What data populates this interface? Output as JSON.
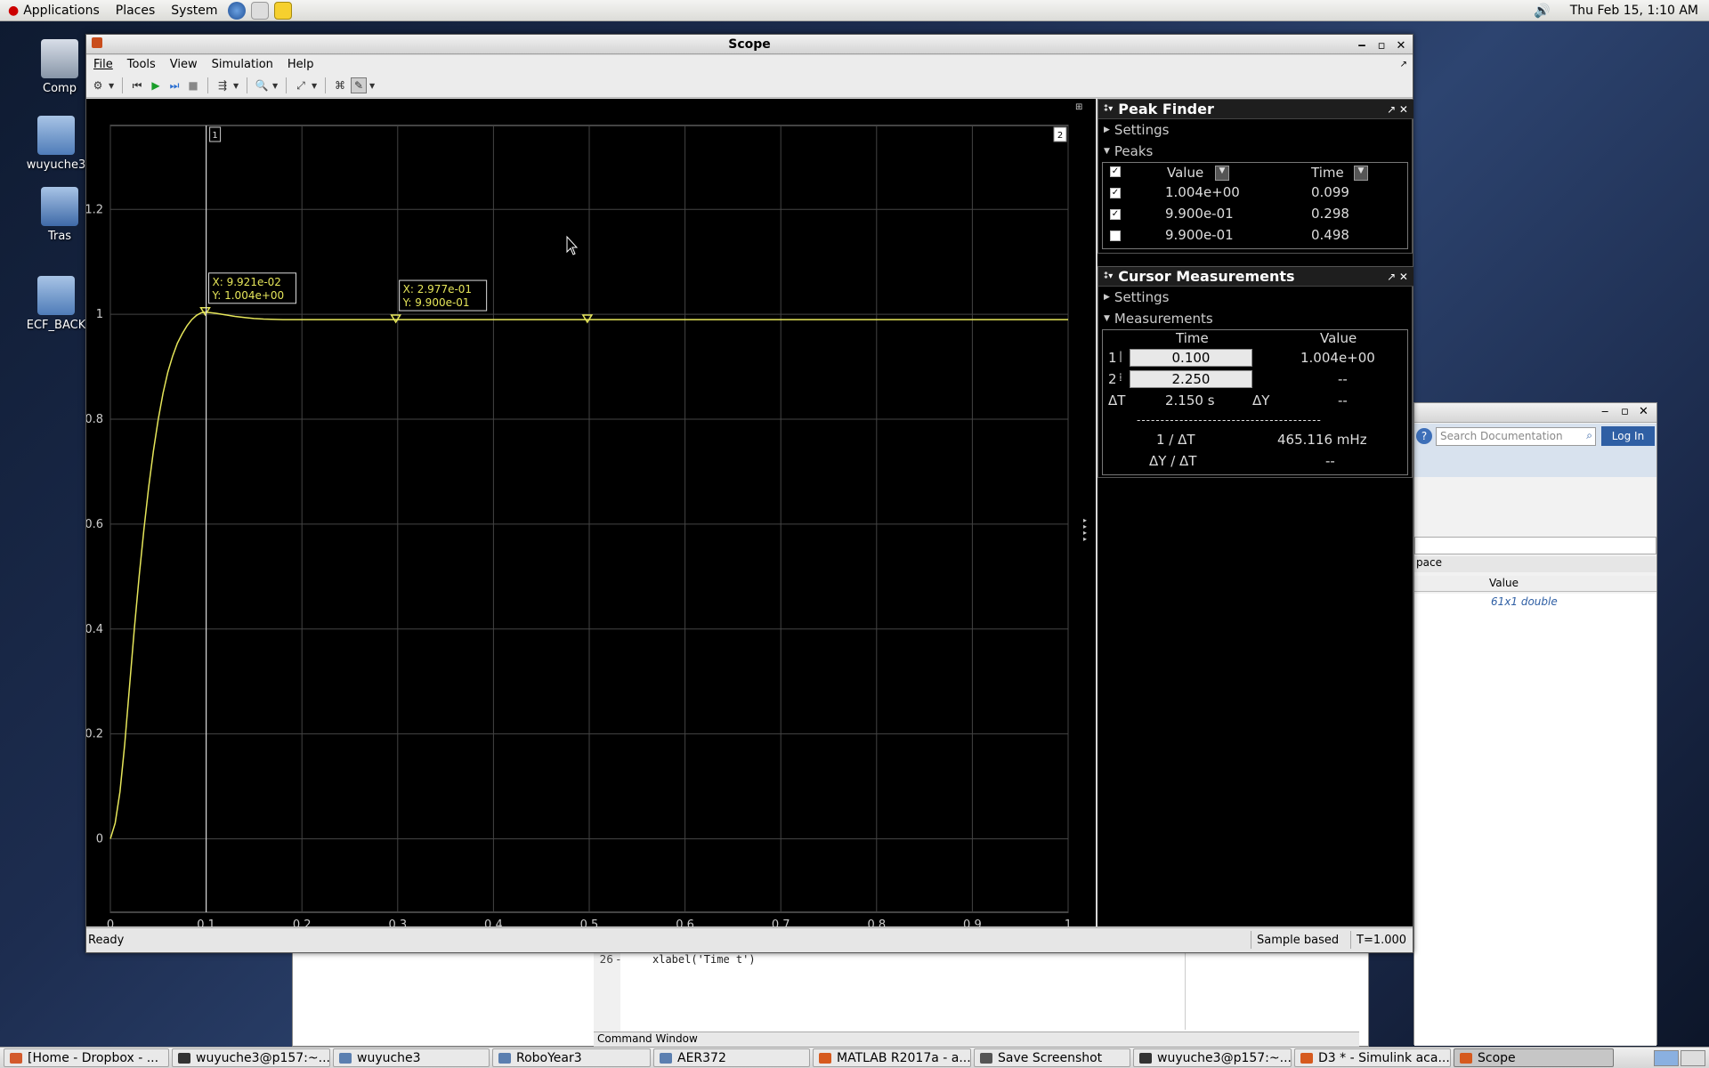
{
  "top_panel": {
    "applications": "Applications",
    "places": "Places",
    "system": "System",
    "clock": "Thu Feb 15,  1:10 AM"
  },
  "desktop_icons": [
    {
      "label": "Comp"
    },
    {
      "label": "wuyuche3"
    },
    {
      "label": "Tras"
    },
    {
      "label": "ECF_BACK"
    }
  ],
  "matlab_window": {
    "search_placeholder": "Search Documentation",
    "login": "Log In",
    "workspace_partial": "pace",
    "value_header": "Value",
    "value_cell": "61x1 double"
  },
  "editor": {
    "line_number": "26",
    "code": "xlabel('Time t')",
    "command_window": "Command Window"
  },
  "scope": {
    "title": "Scope",
    "menu": [
      "File",
      "Tools",
      "View",
      "Simulation",
      "Help"
    ],
    "status": {
      "ready": "Ready",
      "mode": "Sample based",
      "time": "T=1.000"
    },
    "cursor_labels": [
      "1",
      "2"
    ],
    "datatips": [
      {
        "x": "X:  9.921e-02",
        "y": "Y:  1.004e+00"
      },
      {
        "x": "X:  2.977e-01",
        "y": "Y:  9.900e-01"
      }
    ]
  },
  "peak_finder": {
    "title": "Peak Finder",
    "settings": "Settings",
    "peaks": "Peaks",
    "headers": {
      "value": "Value",
      "time": "Time"
    },
    "rows": [
      {
        "value": "1.004e+00",
        "time": "0.099",
        "checked": true
      },
      {
        "value": "9.900e-01",
        "time": "0.298",
        "checked": true
      },
      {
        "value": "9.900e-01",
        "time": "0.498",
        "checked": false
      }
    ]
  },
  "cursor_measurements": {
    "title": "Cursor Measurements",
    "settings": "Settings",
    "measurements": "Measurements",
    "headers": {
      "time": "Time",
      "value": "Value"
    },
    "rows": [
      {
        "idx": "1",
        "time": "0.100",
        "value": "1.004e+00"
      },
      {
        "idx": "2",
        "time": "2.250",
        "value": "--"
      }
    ],
    "dT_label": "ΔT",
    "dT_value": "2.150 s",
    "dY_label": "ΔY",
    "dY_value": "--",
    "separator": "---------------------------------------",
    "inv_dT_label": "1 / ΔT",
    "inv_dT_value": "465.116 mHz",
    "dYdT_label": "ΔY / ΔT",
    "dYdT_value": "--"
  },
  "taskbar": [
    {
      "label": "[Home - Dropbox - ...",
      "color": "#d35a2c"
    },
    {
      "label": "wuyuche3@p157:~...",
      "color": "#333333"
    },
    {
      "label": "wuyuche3",
      "color": "#5b7fb0"
    },
    {
      "label": "RoboYear3",
      "color": "#5b7fb0"
    },
    {
      "label": "AER372",
      "color": "#5b7fb0"
    },
    {
      "label": "MATLAB R2017a - a...",
      "color": "#d65a1e"
    },
    {
      "label": "Save Screenshot",
      "color": "#555555"
    },
    {
      "label": "wuyuche3@p157:~...",
      "color": "#333333"
    },
    {
      "label": "D3 * - Simulink aca...",
      "color": "#d65a1e"
    },
    {
      "label": "Scope",
      "color": "#d65a1e",
      "active": true
    }
  ],
  "chart_data": {
    "type": "line",
    "title": "",
    "xlabel": "",
    "ylabel": "",
    "xlim": [
      0,
      1
    ],
    "ylim": [
      -0.14,
      1.36
    ],
    "x_ticks": [
      "0",
      "0.1",
      "0.2",
      "0.3",
      "0.4",
      "0.5",
      "0.6",
      "0.7",
      "0.8",
      "0.9",
      "1"
    ],
    "y_ticks": [
      "0",
      "0.2",
      "0.4",
      "0.6",
      "0.8",
      "1",
      "1.2"
    ],
    "grid": true,
    "line_color": "#e6e65a",
    "series": [
      {
        "x": [
          0,
          0.005,
          0.01,
          0.015,
          0.02,
          0.025,
          0.03,
          0.035,
          0.04,
          0.045,
          0.05,
          0.055,
          0.06,
          0.065,
          0.07,
          0.075,
          0.08,
          0.085,
          0.09,
          0.095,
          0.099,
          0.105,
          0.11,
          0.12,
          0.13,
          0.14,
          0.15,
          0.16,
          0.18,
          0.2,
          0.25,
          0.3,
          0.4,
          0.5,
          0.6,
          0.8,
          1.0
        ],
        "y": [
          0,
          0.03,
          0.09,
          0.18,
          0.29,
          0.4,
          0.5,
          0.59,
          0.67,
          0.74,
          0.8,
          0.85,
          0.89,
          0.92,
          0.945,
          0.963,
          0.978,
          0.99,
          0.998,
          1.003,
          1.004,
          1.003,
          1.002,
          0.999,
          0.996,
          0.994,
          0.992,
          0.991,
          0.99,
          0.99,
          0.99,
          0.99,
          0.99,
          0.99,
          0.99,
          0.99,
          0.99
        ]
      }
    ],
    "peak_markers": [
      {
        "x": 0.099,
        "y": 1.004
      },
      {
        "x": 0.298,
        "y": 0.99
      },
      {
        "x": 0.498,
        "y": 0.99
      }
    ],
    "cursors": [
      {
        "x": 0.1,
        "label": "1"
      },
      {
        "x": 2.25,
        "label": "2"
      }
    ]
  }
}
